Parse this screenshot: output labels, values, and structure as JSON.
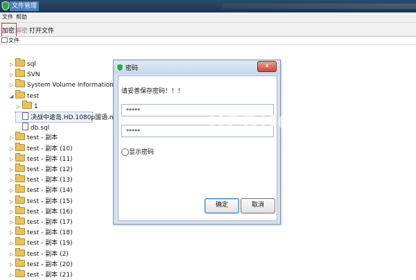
{
  "window": {
    "title": "文件管理"
  },
  "menu": {
    "items": [
      "文件",
      "帮助"
    ]
  },
  "toolbar": {
    "encrypt": "加密",
    "decrypt": "解密",
    "open_file": "打开文件"
  },
  "tab": {
    "label": "文件"
  },
  "tree": [
    {
      "label": "sql",
      "type": "folder",
      "expander": "▷",
      "depth": 0
    },
    {
      "label": "SVN",
      "type": "folder",
      "expander": "▷",
      "depth": 0
    },
    {
      "label": "System Volume Information",
      "type": "folder",
      "expander": "▷",
      "depth": 0
    },
    {
      "label": "test",
      "type": "folder",
      "expander": "◢",
      "depth": 0
    },
    {
      "label": "1",
      "type": "folder",
      "expander": "▷",
      "depth": 1
    },
    {
      "label": "决战中途岛.HD.1080p国语.mkv",
      "type": "file",
      "expander": "",
      "depth": 1,
      "selected": true
    },
    {
      "label": "db.sql",
      "type": "file",
      "expander": "",
      "depth": 1
    },
    {
      "label": "test - 副本",
      "type": "folder",
      "expander": "▷",
      "depth": 0
    },
    {
      "label": "test - 副本 (10)",
      "type": "folder",
      "expander": "▷",
      "depth": 0
    },
    {
      "label": "test - 副本 (11)",
      "type": "folder",
      "expander": "▷",
      "depth": 0
    },
    {
      "label": "test - 副本 (12)",
      "type": "folder",
      "expander": "▷",
      "depth": 0
    },
    {
      "label": "test - 副本 (13)",
      "type": "folder",
      "expander": "▷",
      "depth": 0
    },
    {
      "label": "test - 副本 (14)",
      "type": "folder",
      "expander": "▷",
      "depth": 0
    },
    {
      "label": "test - 副本 (15)",
      "type": "folder",
      "expander": "▷",
      "depth": 0
    },
    {
      "label": "test - 副本 (16)",
      "type": "folder",
      "expander": "▷",
      "depth": 0
    },
    {
      "label": "test - 副本 (17)",
      "type": "folder",
      "expander": "▷",
      "depth": 0
    },
    {
      "label": "test - 副本 (18)",
      "type": "folder",
      "expander": "▷",
      "depth": 0
    },
    {
      "label": "test - 副本 (19)",
      "type": "folder",
      "expander": "▷",
      "depth": 0
    },
    {
      "label": "test - 副本 (2)",
      "type": "folder",
      "expander": "▷",
      "depth": 0
    },
    {
      "label": "test - 副本 (20)",
      "type": "folder",
      "expander": "▷",
      "depth": 0
    },
    {
      "label": "test - 副本 (21)",
      "type": "folder",
      "expander": "▷",
      "depth": 0
    }
  ],
  "dialog": {
    "title": "密码",
    "close": "x",
    "prompt": "请妥善保存密码！！！",
    "password_value": "*****",
    "confirm_value": "*****",
    "show_password_label": "显示密码",
    "ok_label": "确定",
    "cancel_label": "取消"
  },
  "watermark": "UEBUG",
  "colors": {
    "titlebar": "#1c3450",
    "dialog_frame": "#d3e1f0",
    "close_button": "#c74c38",
    "folder": "#e8c25a",
    "annotation_red": "#d83030"
  }
}
